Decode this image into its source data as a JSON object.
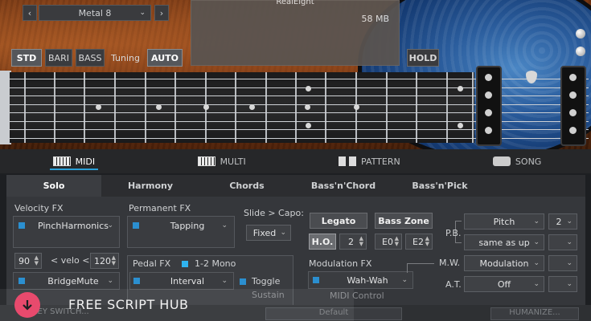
{
  "preset": {
    "name": "Metal 8",
    "prev_icon": "chevron-left-icon",
    "next_icon": "chevron-right-icon"
  },
  "info_panel": {
    "title": "RealEight",
    "size": "58 MB"
  },
  "tuning": {
    "std": "STD",
    "bari": "BARI",
    "bass": "BASS",
    "label": "Tuning",
    "auto": "AUTO",
    "hold": "HOLD"
  },
  "main_tabs": [
    {
      "label": "MIDI",
      "icon": "piano-keyboard-icon",
      "active": true
    },
    {
      "label": "MULTI",
      "icon": "piano-keyboard-icon",
      "active": false
    },
    {
      "label": "PATTERN",
      "icon": "pattern-blocks-icon",
      "active": false
    },
    {
      "label": "SONG",
      "icon": "song-icon",
      "active": false
    }
  ],
  "sub_tabs": [
    "Solo",
    "Harmony",
    "Chords",
    "Bass'n'Chord",
    "Bass'n'Pick"
  ],
  "velocity_fx": {
    "label": "Velocity FX",
    "value": "PinchHarmonics",
    "low": "90",
    "mid_label": "< velo <",
    "high": "120",
    "second": "BridgeMute"
  },
  "permanent_fx": {
    "label": "Permanent FX",
    "value": "Tapping"
  },
  "slide_capo": {
    "label": "Slide > Capo:",
    "value": "Fixed"
  },
  "pedal_fx": {
    "label": "Pedal FX",
    "mono_label": "1-2 Mono",
    "value": "Interval",
    "toggle_label": "Toggle",
    "sustain_label": "Sustain"
  },
  "legato": {
    "label": "Legato",
    "ho_label": "H.O.",
    "ho_value": "2"
  },
  "bass_zone": {
    "label": "Bass Zone",
    "low": "E0",
    "high": "E2"
  },
  "modulation_fx": {
    "label": "Modulation FX",
    "value": "Wah-Wah",
    "midi_control": "MIDI Control"
  },
  "pb": {
    "label": "P.B.",
    "pitch": "Pitch",
    "pitch_value": "2",
    "up": "same as up"
  },
  "mw": {
    "label": "M.W.",
    "value": "Modulation"
  },
  "at": {
    "label": "A.T.",
    "value": "Off"
  },
  "bottom": {
    "keyswitch": "KEY SWITCH...",
    "default": "Default",
    "humanize": "HUMANIZE..."
  },
  "watermark": {
    "text": "FREE SCRIPT HUB",
    "icon": "download-arrow-icon"
  }
}
